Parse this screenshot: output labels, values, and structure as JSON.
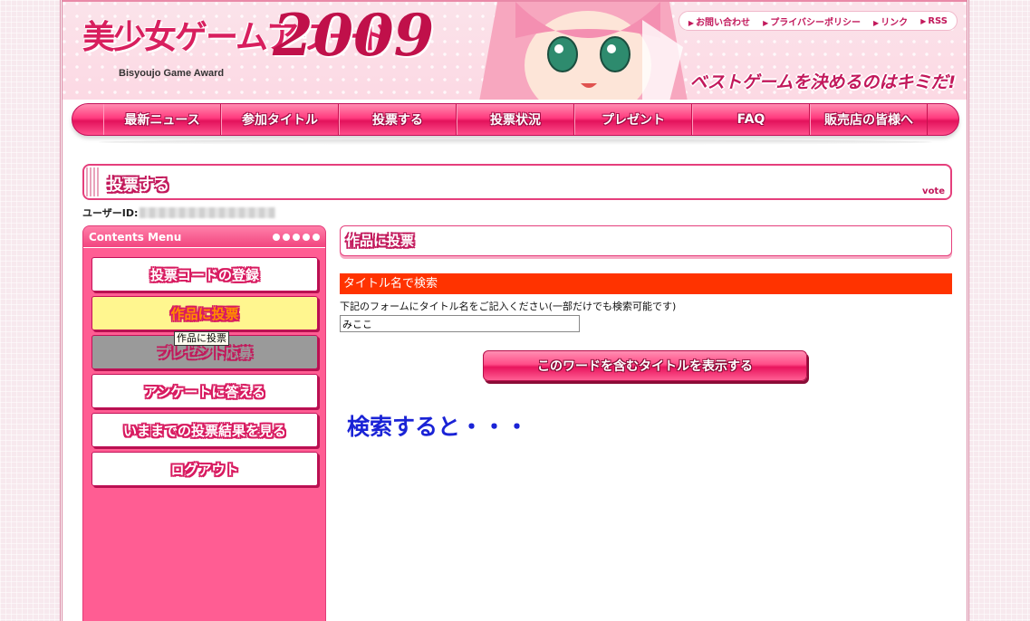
{
  "header": {
    "logo_title": "美少女ゲームアワード",
    "logo_year": "2009",
    "logo_sub": "Bisyoujo Game Award",
    "catch": "ベストゲームを決めるのはキミだ!",
    "utility_links": [
      "お問い合わせ",
      "プライバシーポリシー",
      "リンク",
      "RSS"
    ]
  },
  "nav": {
    "items": [
      "最新ニュース",
      "参加タイトル",
      "投票する",
      "投票状況",
      "プレゼント",
      "FAQ",
      "販売店の皆様へ"
    ]
  },
  "section": {
    "title": "投票する",
    "en": "vote"
  },
  "user": {
    "label": "ユーザーID:"
  },
  "sidebar": {
    "head": "Contents Menu",
    "items": [
      "投票コードの登録",
      "作品に投票",
      "プレゼント応募",
      "アンケートに答える",
      "いままでの投票結果を見る",
      "ログアウト"
    ],
    "tooltip": "作品に投票"
  },
  "main": {
    "title": "作品に投票",
    "search_bar": "タイトル名で検索",
    "instruction": "下記のフォームにタイトル名をご記入ください(一部だけでも検索可能です)",
    "input_value": "みここ",
    "submit_label": "このワードを含むタイトルを表示する",
    "big_text": "検索すると・・・"
  },
  "colors": {
    "accent": "#ff3b7e",
    "search_bar": "#ff3300",
    "big_text": "#1a23d6",
    "active_menu": "#fff68f"
  }
}
